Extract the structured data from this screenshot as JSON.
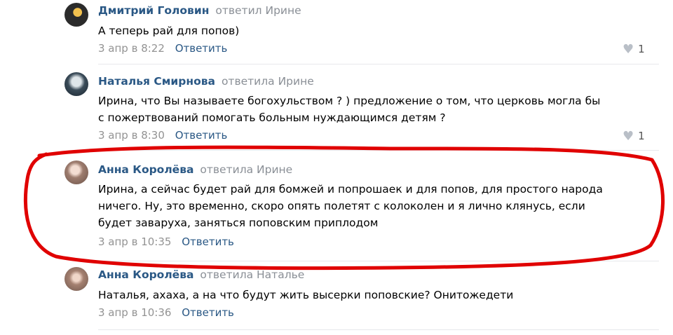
{
  "comments": [
    {
      "author": "Дмитрий Головин",
      "reply_to": "ответил Ирине",
      "lines": [
        "А теперь рай для попов)"
      ],
      "date": "3 апр в 8:22",
      "reply_label": "Ответить",
      "likes": "1",
      "avatar_icon": "avatar"
    },
    {
      "author": "Наталья Смирнова",
      "reply_to": "ответила Ирине",
      "lines": [
        "Ирина, что Вы называете богохульством ? ) предложение о том, что церковь могла бы",
        "с пожертвований помогать больным нуждающимся детям ?"
      ],
      "date": "3 апр в 8:30",
      "reply_label": "Ответить",
      "likes": "1",
      "avatar_icon": "avatar"
    },
    {
      "author": "Анна Королёва",
      "reply_to": "ответила Ирине",
      "lines": [
        "Ирина, а сейчас будет рай для бомжей и попрошаек и для попов, для простого народа",
        "ничего. Ну, это временно, скоро опять полетят с колоколен и я лично клянусь, если",
        "будет заваруха, заняться поповским приплодом"
      ],
      "date": "3 апр в 10:35",
      "reply_label": "Ответить",
      "avatar_icon": "avatar"
    },
    {
      "author": "Анна Королёва",
      "reply_to": "ответила Наталье",
      "lines": [
        "Наталья, ахаха, а на что будут жить высерки поповские? Онитожедети"
      ],
      "date": "3 апр в 10:36",
      "reply_label": "Ответить",
      "avatar_icon": "avatar"
    }
  ],
  "icons": {
    "like": "heart-icon"
  },
  "colors": {
    "author_link": "#2a5885",
    "secondary_text": "#939393",
    "highlight_marker": "#e00000"
  }
}
